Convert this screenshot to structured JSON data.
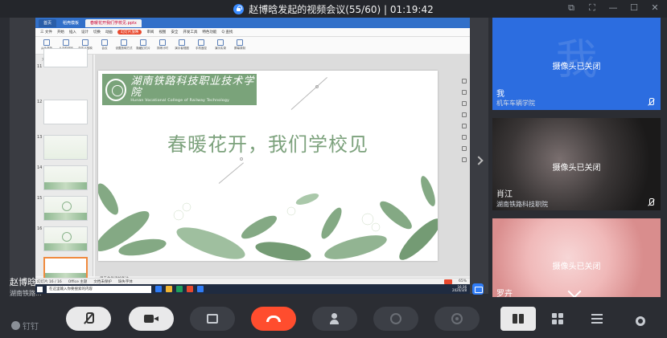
{
  "meeting": {
    "title": "赵博晗发起的视频会议(55/60) | 01:19:42"
  },
  "window_controls": {
    "restore": "⧉",
    "fullscreen": "⛶",
    "minimize": "—",
    "maximize": "☐",
    "close": "✕"
  },
  "wps": {
    "tabs": [
      "首页",
      "稻壳模板",
      "春暖花开我们学校见.pptx"
    ],
    "menu": [
      "三 文件",
      "开始",
      "插入",
      "设计",
      "切换",
      "动画",
      "幻灯片放映",
      "审阅",
      "视图",
      "安全",
      "开发工具",
      "特色功能",
      "Q 查找"
    ],
    "ribbon": [
      "从头开始",
      "从当前开始",
      "自定义放映",
      "会议",
      "设置放映方式",
      "隐藏幻灯片",
      "排练计时",
      "演示者视图",
      "手机遥控",
      "演示实录",
      "屏幕录制"
    ],
    "panel_tabs": [
      "大纲",
      "幻灯片"
    ],
    "thumb_numbers": [
      "11",
      "12",
      "13",
      "14",
      "15",
      "16"
    ],
    "slide": {
      "logo_cn": "湖南铁路科技职业技术学院",
      "logo_en": "Hunan Vocational College of Railway Technology",
      "title": "春暖花开，我们学校见"
    },
    "note_hint": "单击此处添加备注",
    "status": [
      "幻灯片 16 / 16",
      "Office 主题",
      "文档未保护",
      "缺失字体"
    ],
    "zoom": "65%",
    "taskbar_search": "在这里输入你要搜索的内容",
    "clock_time": "16:36",
    "clock_date": "2020/3/8"
  },
  "presenter": {
    "name": "赵博晗",
    "org": "湖南铁路..."
  },
  "participants": [
    {
      "name": "我",
      "org": "机车车辆学院",
      "camera": "摄像头已关闭",
      "avatar_text": "我"
    },
    {
      "name": "肖江",
      "org": "湖南铁路科技职院",
      "camera": "摄像头已关闭"
    },
    {
      "name": "罗卉",
      "org": "",
      "camera": "摄像头已关闭"
    }
  ],
  "brand": "钉钉",
  "colors": {
    "hangup": "#ff4d2e",
    "self_tile": "#2c6de0",
    "slide_green": "#7aa37a"
  },
  "icons": {
    "mic": "mic-muted-icon",
    "camera": "camera-off-icon",
    "share": "share-screen-icon",
    "hangup": "hang-up-icon",
    "add_member": "add-user-icon",
    "translate": "caption-icon",
    "record": "record-icon",
    "speaker_view": "speaker-layout-icon",
    "grid_view": "grid-layout-icon",
    "list_view": "list-layout-icon",
    "settings": "gear-icon"
  }
}
